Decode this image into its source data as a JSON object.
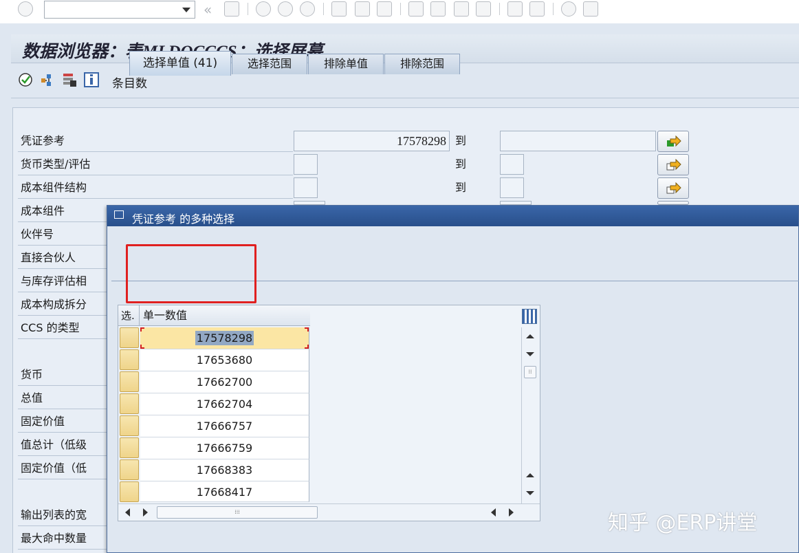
{
  "page": {
    "title": "数据浏览器：表MLDOCCCS：选择屏幕"
  },
  "app_toolbar": {
    "entries_label": "条目数"
  },
  "form": {
    "to_label": "到",
    "fields": [
      {
        "label": "凭证参考",
        "value": "17578298"
      },
      {
        "label": "货币类型/评估",
        "value": ""
      },
      {
        "label": "成本组件结构",
        "value": ""
      },
      {
        "label": "成本组件",
        "value": ""
      },
      {
        "label": "伙伴号",
        "value": ""
      },
      {
        "label": "直接合伙人",
        "value": ""
      },
      {
        "label": "与库存评估相",
        "value": ""
      },
      {
        "label": "成本构成拆分",
        "value": ""
      },
      {
        "label": "CCS 的类型",
        "value": ""
      },
      {
        "label": "货币",
        "value": ""
      },
      {
        "label": "总值",
        "value": ""
      },
      {
        "label": "固定价值",
        "value": ""
      },
      {
        "label": "值总计（低级",
        "value": ""
      },
      {
        "label": "固定价值（低",
        "value": ""
      },
      {
        "label": "输出列表的宽",
        "value": ""
      },
      {
        "label": "最大命中数量",
        "value": ""
      }
    ]
  },
  "dialog": {
    "title": "凭证参考 的多种选择",
    "tabs": [
      {
        "label": "选择单值 (41)",
        "active": true
      },
      {
        "label": "选择范围",
        "active": false
      },
      {
        "label": "排除单值",
        "active": false
      },
      {
        "label": "排除范围",
        "active": false
      }
    ],
    "table": {
      "col_select": "选.",
      "col_value": "单一数值",
      "rows": [
        "17578298",
        "17653680",
        "17662700",
        "17662704",
        "17666757",
        "17666759",
        "17668383",
        "17668417"
      ],
      "selected_index": 0
    }
  },
  "colors": {
    "highlight_box": "#e02020",
    "dialog_title_bg": "#284f8b",
    "selected_row": "#fbe6a4"
  },
  "watermark": "知乎 @ERP讲堂"
}
